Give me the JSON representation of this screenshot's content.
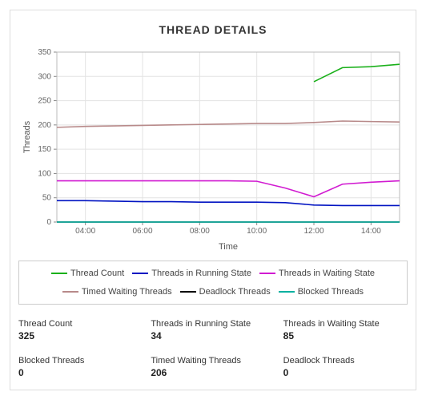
{
  "title": "THREAD DETAILS",
  "chart_data": {
    "type": "line",
    "xlabel": "Time",
    "ylabel": "Threads",
    "x_categories": [
      "04:00",
      "06:00",
      "08:00",
      "10:00",
      "12:00",
      "14:00"
    ],
    "y_ticks": [
      0,
      50,
      100,
      150,
      200,
      250,
      300,
      350
    ],
    "ylim": [
      0,
      350
    ],
    "x_index_range": [
      0,
      12
    ],
    "series": [
      {
        "name": "Thread Count",
        "color": "#1ab01a",
        "values": [
          null,
          null,
          null,
          null,
          null,
          null,
          null,
          null,
          null,
          289,
          318,
          320,
          325
        ]
      },
      {
        "name": "Threads in Running State",
        "color": "#0214c2",
        "values": [
          44,
          44,
          43,
          42,
          42,
          41,
          41,
          41,
          40,
          35,
          34,
          34,
          34
        ]
      },
      {
        "name": "Threads in Waiting State",
        "color": "#d11bd1",
        "values": [
          85,
          85,
          85,
          85,
          85,
          85,
          85,
          84,
          70,
          52,
          78,
          82,
          85
        ]
      },
      {
        "name": "Timed Waiting Threads",
        "color": "#b88a8a",
        "values": [
          195,
          197,
          198,
          199,
          200,
          201,
          202,
          203,
          203,
          205,
          208,
          207,
          206
        ]
      },
      {
        "name": "Deadlock Threads",
        "color": "#000000",
        "values": [
          0,
          0,
          0,
          0,
          0,
          0,
          0,
          0,
          0,
          0,
          0,
          0,
          0
        ]
      },
      {
        "name": "Blocked Threads",
        "color": "#00b0a0",
        "values": [
          0,
          0,
          0,
          0,
          0,
          0,
          0,
          0,
          0,
          0,
          0,
          0,
          0
        ]
      }
    ]
  },
  "legend": [
    {
      "label": "Thread Count",
      "color": "#1ab01a"
    },
    {
      "label": "Threads in Running State",
      "color": "#0214c2"
    },
    {
      "label": "Threads in Waiting State",
      "color": "#d11bd1"
    },
    {
      "label": "Timed Waiting Threads",
      "color": "#b88a8a"
    },
    {
      "label": "Deadlock Threads",
      "color": "#000000"
    },
    {
      "label": "Blocked Threads",
      "color": "#00b0a0"
    }
  ],
  "stats": [
    {
      "label": "Thread Count",
      "value": "325"
    },
    {
      "label": "Threads in Running State",
      "value": "34"
    },
    {
      "label": "Threads in Waiting State",
      "value": "85"
    },
    {
      "label": "Blocked Threads",
      "value": "0"
    },
    {
      "label": "Timed Waiting Threads",
      "value": "206"
    },
    {
      "label": "Deadlock Threads",
      "value": "0"
    }
  ]
}
